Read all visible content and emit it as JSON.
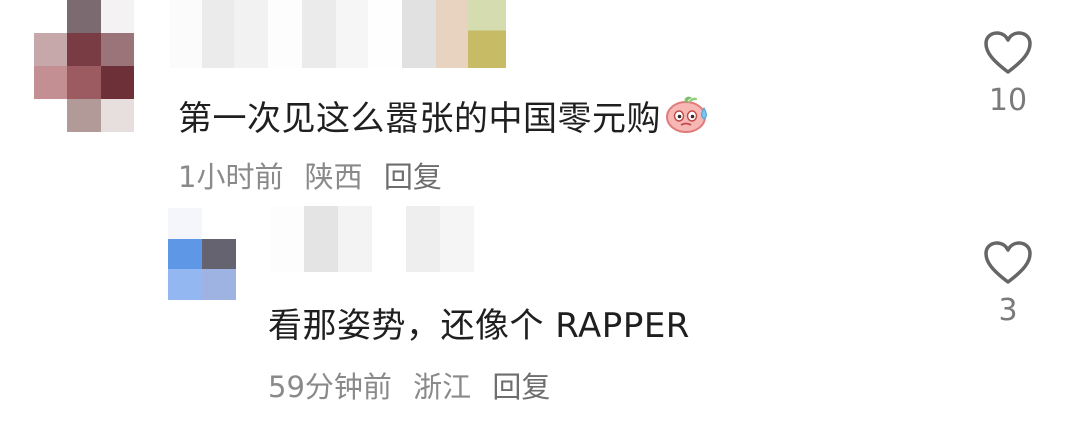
{
  "comments": [
    {
      "text": "第一次见这么嚣张的中国零元购",
      "emoji": "sweating-peach-emoji",
      "time": "1小时前",
      "location": "陕西",
      "reply_label": "回复",
      "likes": "10"
    },
    {
      "text": "看那姿势，还像个 RAPPER",
      "time": "59分钟前",
      "location": "浙江",
      "reply_label": "回复",
      "likes": "3"
    }
  ],
  "icons": {
    "like": "heart-outline-icon"
  },
  "colors": {
    "text": "#1f1f1f",
    "meta": "#8a8a8a",
    "icon": "#666666"
  }
}
